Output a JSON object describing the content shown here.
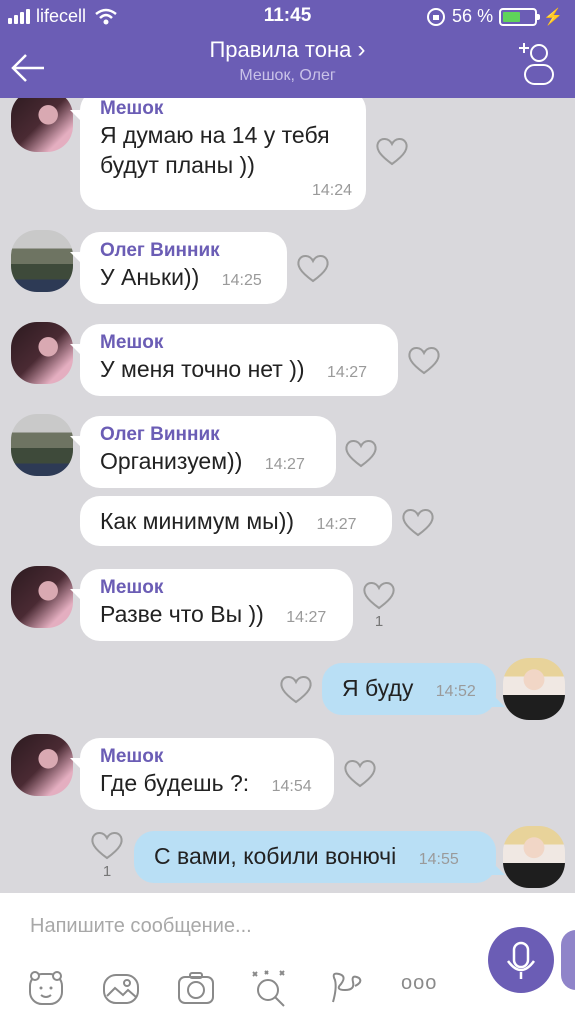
{
  "status": {
    "carrier": "lifecell",
    "time": "11:45",
    "battery": "56 %"
  },
  "header": {
    "title": "Правила тона",
    "title_chevron": "›",
    "subtitle": "Мешок, Олег"
  },
  "messages": [
    {
      "sender": "Мешок",
      "lines": [
        "Я думаю на 14 у тебя",
        "будут планы ))"
      ],
      "time": "14:24"
    },
    {
      "sender": "Олег Винник",
      "lines": [
        "У Аньки))"
      ],
      "time": "14:25"
    },
    {
      "sender": "Мешок",
      "lines": [
        "У меня точно нет ))"
      ],
      "time": "14:27"
    },
    {
      "sender": "Олег Винник",
      "lines": [
        "Организуем))"
      ],
      "time": "14:27"
    },
    {
      "sender": "",
      "lines": [
        "Как минимум мы))"
      ],
      "time": "14:27"
    },
    {
      "sender": "Мешок",
      "lines": [
        "Разве что Вы ))"
      ],
      "time": "14:27",
      "likes": "1"
    },
    {
      "sender": "",
      "lines": [
        "Я буду"
      ],
      "time": "14:52"
    },
    {
      "sender": "Мешок",
      "lines": [
        "Где будешь ?:"
      ],
      "time": "14:54"
    },
    {
      "sender": "",
      "lines": [
        "С вами, кобили вонючі"
      ],
      "time": "14:55",
      "likes": "1"
    }
  ],
  "composer": {
    "placeholder": "Напишите сообщение...",
    "more": "ooo"
  },
  "colors": {
    "header": "#6b5db5",
    "incoming": "#ffffff",
    "outgoing": "#b9dff5",
    "background": "#d9d8dc"
  }
}
